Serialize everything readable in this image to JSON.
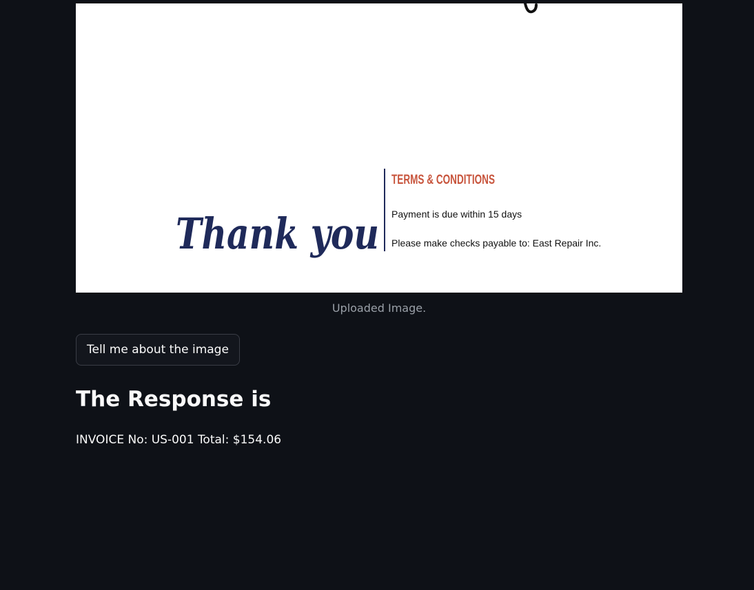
{
  "uploaded_image": {
    "thank_you_text": "Thank you",
    "terms_heading": "TERMS & CONDITIONS",
    "terms_line_1": "Payment is due within 15 days",
    "terms_line_2": "Please make checks payable to: East Repair Inc.",
    "colors": {
      "thank_you": "#1f2a5a",
      "terms_heading": "#c8553d",
      "divider": "#1f2a5a"
    }
  },
  "caption": "Uploaded Image.",
  "button_label": "Tell me about the image",
  "response_heading": "The Response is",
  "response_text": "INVOICE No: US-001 Total: $154.06"
}
